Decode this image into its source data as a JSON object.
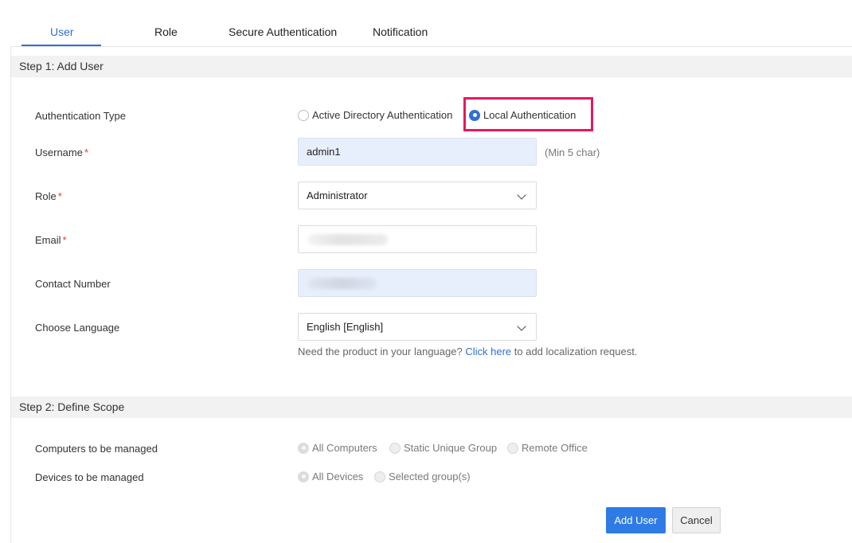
{
  "tabs": [
    {
      "label": "User",
      "active": true
    },
    {
      "label": "Role",
      "active": false
    },
    {
      "label": "Secure Authentication",
      "active": false
    },
    {
      "label": "Notification",
      "active": false
    }
  ],
  "step1": {
    "title": "Step 1: Add User",
    "auth_type": {
      "label": "Authentication Type",
      "options": [
        "Active Directory Authentication",
        "Local Authentication"
      ],
      "selected": "Local Authentication"
    },
    "username": {
      "label": "Username",
      "required_mark": "*",
      "value": "admin1",
      "hint": "(Min 5 char)"
    },
    "role": {
      "label": "Role",
      "required_mark": "*",
      "value": "Administrator"
    },
    "email": {
      "label": "Email",
      "required_mark": "*",
      "value": ""
    },
    "contact": {
      "label": "Contact Number",
      "value": ""
    },
    "language": {
      "label": "Choose Language",
      "value": "English [English]",
      "note_prefix": "Need the product in your language?",
      "note_link": "Click here",
      "note_suffix": "to add localization request."
    }
  },
  "step2": {
    "title": "Step 2: Define Scope",
    "computers": {
      "label": "Computers to be managed",
      "options": [
        "All Computers",
        "Static Unique Group",
        "Remote Office"
      ],
      "selected": "All Computers"
    },
    "devices": {
      "label": "Devices to be managed",
      "options": [
        "All Devices",
        "Selected group(s)"
      ],
      "selected": "All Devices"
    }
  },
  "actions": {
    "add_user": "Add User",
    "cancel": "Cancel"
  },
  "colors": {
    "accent": "#2f6fd6",
    "highlight": "#e8175d",
    "required": "#e03a3a"
  }
}
